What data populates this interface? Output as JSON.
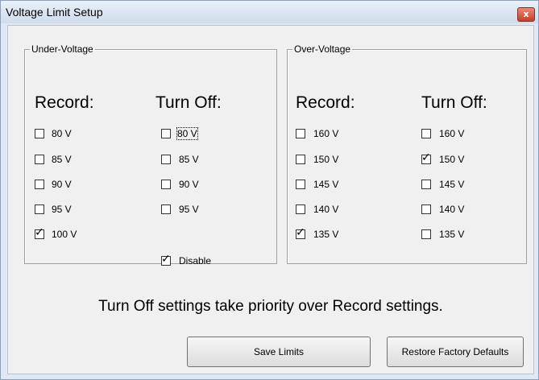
{
  "window": {
    "title": "Voltage Limit Setup",
    "close_glyph": "x"
  },
  "under": {
    "legend": "Under-Voltage",
    "record_header": "Record:",
    "turnoff_header": "Turn Off:",
    "record": [
      {
        "label": "80 V",
        "checked": false
      },
      {
        "label": "85 V",
        "checked": false
      },
      {
        "label": "90 V",
        "checked": false
      },
      {
        "label": "95 V",
        "checked": false
      },
      {
        "label": "100 V",
        "checked": true
      }
    ],
    "turnoff": [
      {
        "label": "80 V",
        "checked": false
      },
      {
        "label": "85 V",
        "checked": false
      },
      {
        "label": "90 V",
        "checked": false
      },
      {
        "label": "95 V",
        "checked": false
      }
    ],
    "disable": {
      "label": "Disable",
      "checked": true
    }
  },
  "over": {
    "legend": "Over-Voltage",
    "record_header": "Record:",
    "turnoff_header": "Turn Off:",
    "record": [
      {
        "label": "160 V",
        "checked": false
      },
      {
        "label": "150 V",
        "checked": false
      },
      {
        "label": "145 V",
        "checked": false
      },
      {
        "label": "140 V",
        "checked": false
      },
      {
        "label": "135 V",
        "checked": true
      }
    ],
    "turnoff": [
      {
        "label": "160 V",
        "checked": false
      },
      {
        "label": "150 V",
        "checked": true
      },
      {
        "label": "145 V",
        "checked": false
      },
      {
        "label": "140 V",
        "checked": false
      },
      {
        "label": "135 V",
        "checked": false
      }
    ]
  },
  "note": "Turn Off settings take priority over Record settings.",
  "buttons": {
    "save": "Save Limits",
    "restore": "Restore Factory Defaults"
  }
}
